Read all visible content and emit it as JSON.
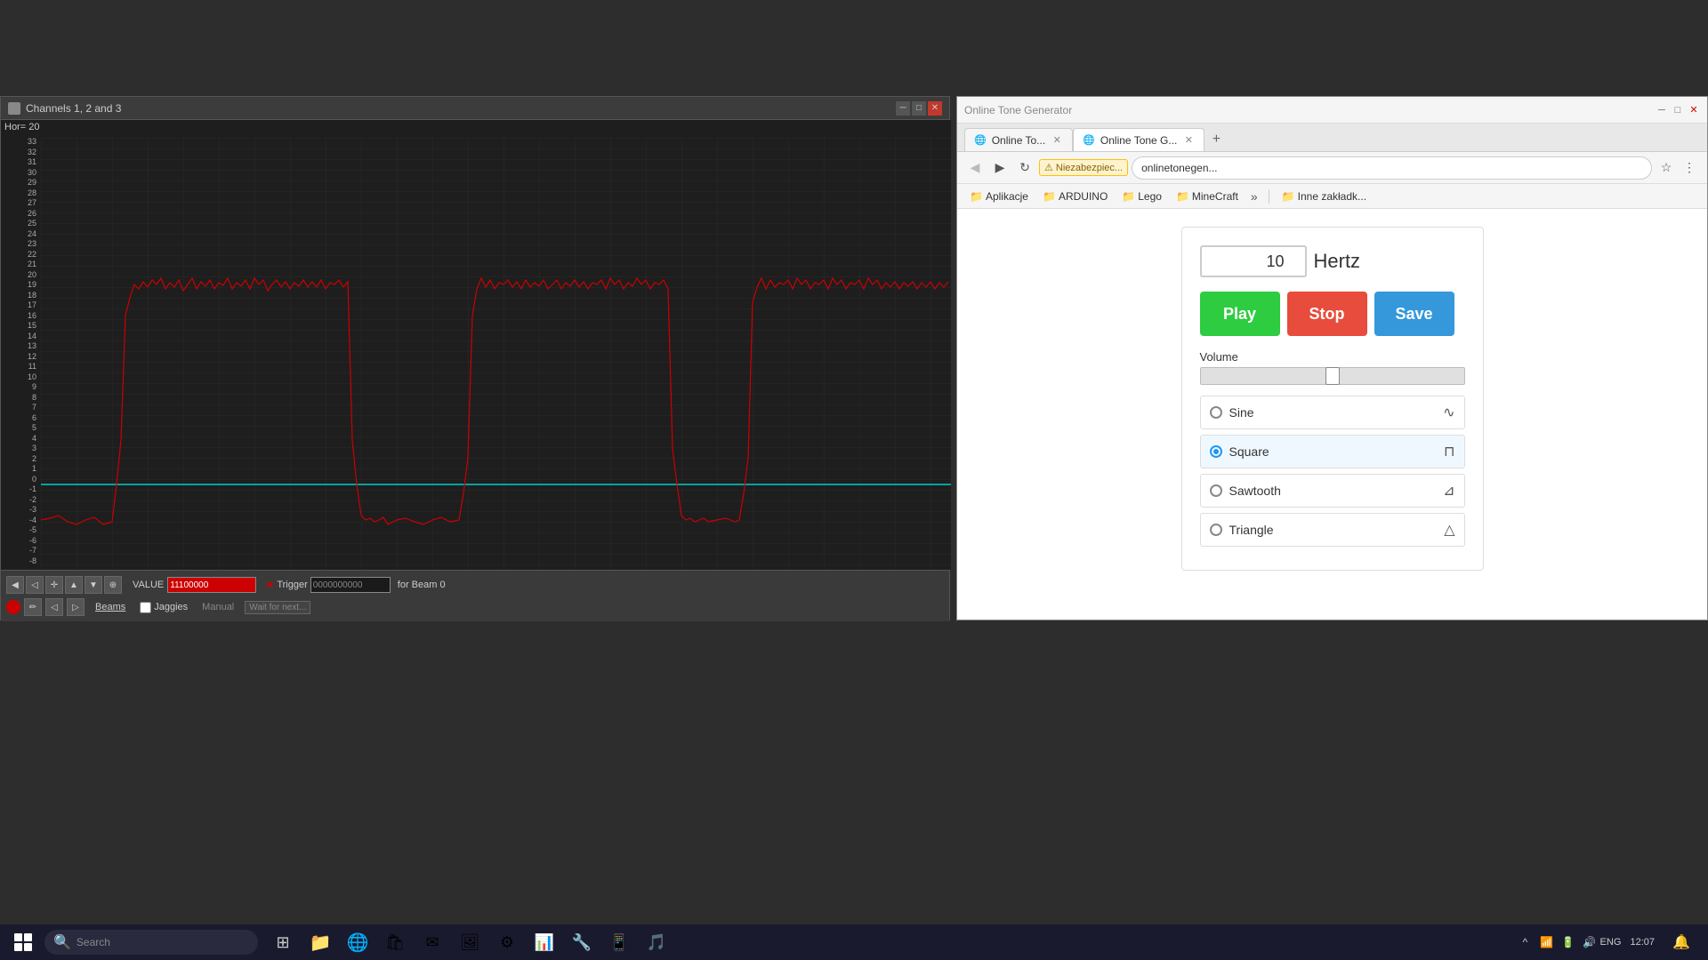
{
  "app": {
    "title": "Channels 1, 2 and 3",
    "hor_label": "Hor= 20",
    "y_labels": [
      "33",
      "32",
      "31",
      "30",
      "29",
      "28",
      "27",
      "26",
      "25",
      "24",
      "23",
      "22",
      "21",
      "20",
      "19",
      "18",
      "17",
      "16",
      "15",
      "14",
      "13",
      "12",
      "11",
      "10",
      "9",
      "8",
      "7",
      "6",
      "5",
      "4",
      "3",
      "2",
      "1",
      "0",
      "-1",
      "-2",
      "-3",
      "-4",
      "-5",
      "-6",
      "-7",
      "-8"
    ],
    "value_label": "VALUE",
    "trigger_label": "Trigger",
    "trigger_value": "0000000000",
    "beam_label": "for Beam 0",
    "beams_text": "Beams",
    "jaggies_text": "Jaggies",
    "manual_text": "Manual",
    "wait_text": "Wait for next..."
  },
  "browser": {
    "tab1_label": "Online To...",
    "tab2_label": "Online Tone G...",
    "url": "onlinetonegen...",
    "security": "Niezabezpiec...",
    "bookmarks": [
      "Aplikacje",
      "ARDUINO",
      "Lego",
      "MineCraft"
    ],
    "more_label": "»",
    "inne_label": "Inne zakładk..."
  },
  "tone_generator": {
    "frequency": "10",
    "unit": "Hertz",
    "play_label": "Play",
    "stop_label": "Stop",
    "save_label": "Save",
    "volume_label": "Volume",
    "waveforms": [
      {
        "name": "Sine",
        "selected": false,
        "icon": "∿"
      },
      {
        "name": "Square",
        "selected": true,
        "icon": "⊓"
      },
      {
        "name": "Sawtooth",
        "selected": false,
        "icon": "⊿"
      },
      {
        "name": "Triangle",
        "selected": false,
        "icon": "△"
      }
    ]
  },
  "taskbar": {
    "time": "12:07",
    "language": "ENG"
  }
}
